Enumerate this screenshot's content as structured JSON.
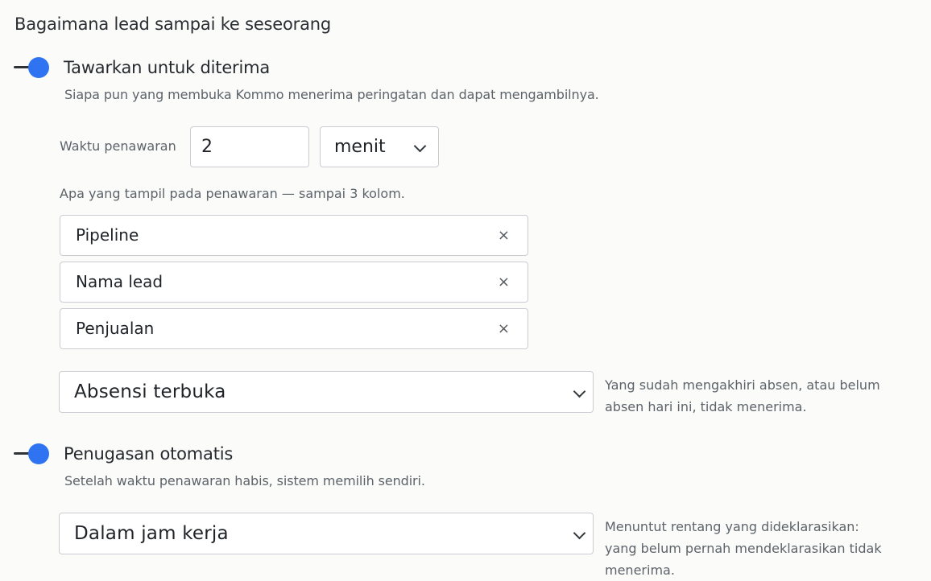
{
  "heading": "Bagaimana lead sampai ke seseorang",
  "offer": {
    "label": "Tawarkan untuk diterima",
    "enabled": true,
    "description": "Siapa pun yang membuka Kommo menerima peringatan dan dapat mengambilnya.",
    "time_label": "Waktu penawaran",
    "time_value": "2",
    "time_unit": "menit",
    "columns_label": "Apa yang tampil pada penawaran — sampai 3 kolom.",
    "columns": [
      "Pipeline",
      "Nama lead",
      "Penjualan"
    ],
    "remove_glyph": "×",
    "attendance_select": "Absensi terbuka",
    "attendance_note_line1": "Yang sudah mengakhiri absen, atau belum",
    "attendance_note_line2": "absen hari ini, tidak menerima."
  },
  "auto_assign": {
    "label": "Penugasan otomatis",
    "enabled": true,
    "description": "Setelah waktu penawaran habis, sistem memilih sendiri.",
    "hours_select": "Dalam jam kerja",
    "hours_note_line1": "Menuntut rentang yang dideklarasikan:",
    "hours_note_line2": "yang belum pernah mendeklarasikan tidak menerima."
  },
  "colors": {
    "toggle_on": "#2f73f2",
    "border": "#c9cdd1"
  },
  "icons": [
    "toggle-switch",
    "chevron-down-icon",
    "close-icon"
  ]
}
